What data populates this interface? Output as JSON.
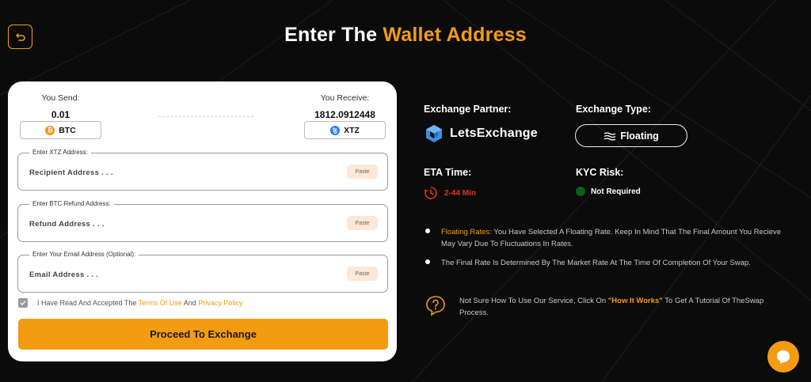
{
  "header": {
    "title_plain": "Enter The",
    "title_accent": "Wallet Address"
  },
  "exchange": {
    "send_label": "You Send:",
    "send_amount": "0.01",
    "send_coin": "BTC",
    "receive_label": "You Receive:",
    "receive_amount": "1812.0912448",
    "receive_coin": "XTZ"
  },
  "fields": [
    {
      "legend": "Enter XTZ Address:",
      "placeholder": "Recipient Address . . .",
      "paste": "Paste"
    },
    {
      "legend": "Enter BTC Refund Address:",
      "placeholder": "Refund Address . . .",
      "paste": "Paste"
    },
    {
      "legend": "Enter Your Email Address (Optional):",
      "placeholder": "Email Address . . .",
      "paste": "Paste"
    }
  ],
  "terms": {
    "prefix": "I Have Read And Accepted The",
    "terms_link": "Terms Of Use",
    "and": "And",
    "privacy_link": "Privacy Policy",
    "checked": true
  },
  "proceed_label": "Proceed To Exchange",
  "info": {
    "partner_heading": "Exchange Partner:",
    "partner_name": "LetsExchange",
    "type_heading": "Exchange Type:",
    "type_value": "Floating",
    "eta_heading": "ETA Time:",
    "eta_value": "2-44 Min",
    "kyc_heading": "KYC Risk:",
    "kyc_value": "Not Required"
  },
  "notes": {
    "floating_label": "Floating Rates:",
    "floating_text": "You Have Selected A Floating Rate. Keep In Mind That The Final Amount You Recieve May Vary Due To Fluctuations In Rates.",
    "final_rate_text": "The Final Rate Is Determined By The Market Rate At The Time Of Completion Of Your Swap.",
    "help_prefix": "Not Sure How To Use Our Service, Click On",
    "help_link": "\"How It Works\"",
    "help_suffix": "To Get A Tutorial Of TheSwap Process."
  },
  "colors": {
    "accent": "#f39c12",
    "background": "#0b0b0b",
    "eta": "#e0321f",
    "kyc_ok": "#0e5e14"
  },
  "icons": [
    "back-arrow-icon",
    "bitcoin-icon",
    "tezos-icon",
    "letsexchange-logo-icon",
    "waves-icon",
    "clock-icon",
    "question-bubble-icon",
    "chat-icon",
    "check-icon"
  ]
}
